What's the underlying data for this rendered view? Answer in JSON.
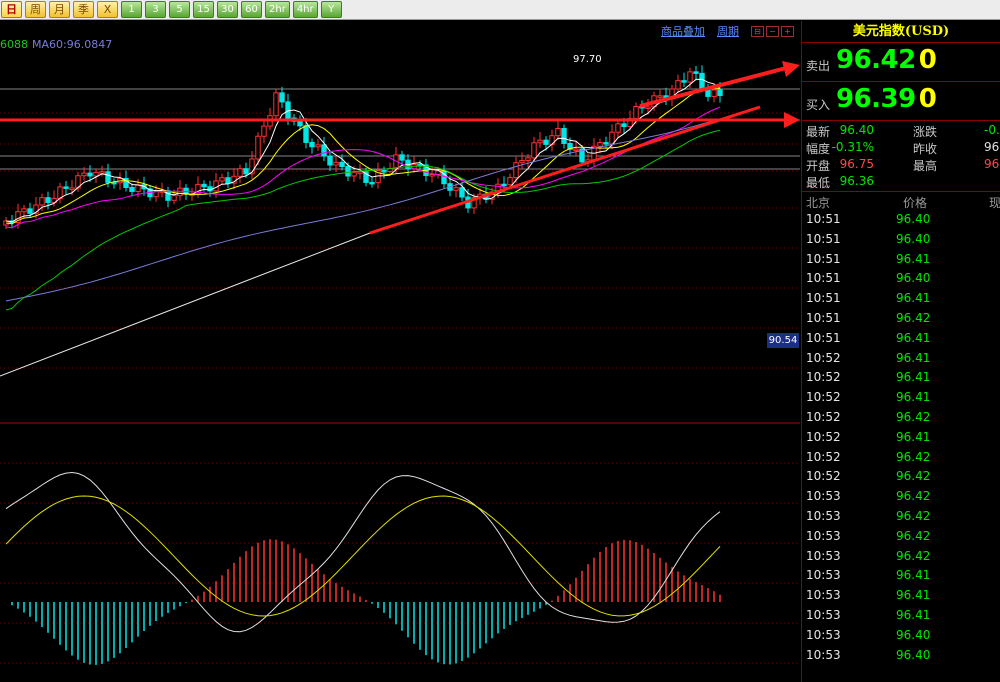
{
  "toolbar": {
    "buttons": [
      {
        "label": "日",
        "style": "first"
      },
      {
        "label": "周",
        "style": "yellow"
      },
      {
        "label": "月",
        "style": "yellow"
      },
      {
        "label": "季",
        "style": "yellow"
      },
      {
        "label": "X",
        "style": "yellow"
      },
      {
        "label": "1",
        "style": "green"
      },
      {
        "label": "3",
        "style": "green"
      },
      {
        "label": "5",
        "style": "green"
      },
      {
        "label": "15",
        "style": "green"
      },
      {
        "label": "30",
        "style": "green"
      },
      {
        "label": "60",
        "style": "green"
      },
      {
        "label": "2hr",
        "style": "green"
      },
      {
        "label": "4hr",
        "style": "green"
      },
      {
        "label": "Y",
        "style": "green"
      }
    ]
  },
  "chart": {
    "ma_legend_a": "6088",
    "ma_legend_b": "MA60:96.0847",
    "overlay_link": "商品叠加",
    "period_link": "周期",
    "high_label": "97.70",
    "cursor_price": "90.54",
    "colors": {
      "up": "#ff3232",
      "down": "#00e6e6",
      "grid": "#7a0000",
      "ma5": "#ffffff",
      "ma10": "#ffff00",
      "ma20": "#ff00ff",
      "ma30": "#00c800",
      "ma60": "#7b7bd6",
      "annotation": "#ff1e1e"
    }
  },
  "panel": {
    "title": "美元指数(USD)",
    "sell_label": "卖出",
    "sell_value": "96.42",
    "sell_suffix": "0",
    "buy_label": "买入",
    "buy_value": "96.39",
    "buy_suffix": "0",
    "stats": [
      {
        "k1": "最新",
        "v1": "96.40",
        "c1": "c-green",
        "k2": "涨跌",
        "v2": "-0.",
        "c2": "c-green"
      },
      {
        "k1": "幅度",
        "v1": "-0.31%",
        "c1": "c-green",
        "k2": "昨收",
        "v2": "96.",
        "c2": "c-white"
      },
      {
        "k1": "开盘",
        "v1": "96.75",
        "c1": "c-red",
        "k2": "最高",
        "v2": "96.",
        "c2": "c-red"
      },
      {
        "k1": "最低",
        "v1": "96.36",
        "c1": "c-green",
        "k2": "",
        "v2": "",
        "c2": "c-white"
      }
    ],
    "tick_headers": {
      "time": "北京",
      "price": "价格",
      "vol": "现"
    },
    "ticks": [
      {
        "time": "10:51",
        "price": "96.40"
      },
      {
        "time": "10:51",
        "price": "96.40"
      },
      {
        "time": "10:51",
        "price": "96.41"
      },
      {
        "time": "10:51",
        "price": "96.40"
      },
      {
        "time": "10:51",
        "price": "96.41"
      },
      {
        "time": "10:51",
        "price": "96.42"
      },
      {
        "time": "10:51",
        "price": "96.41"
      },
      {
        "time": "10:52",
        "price": "96.41"
      },
      {
        "time": "10:52",
        "price": "96.41"
      },
      {
        "time": "10:52",
        "price": "96.41"
      },
      {
        "time": "10:52",
        "price": "96.42"
      },
      {
        "time": "10:52",
        "price": "96.41"
      },
      {
        "time": "10:52",
        "price": "96.42"
      },
      {
        "time": "10:52",
        "price": "96.42"
      },
      {
        "time": "10:53",
        "price": "96.42"
      },
      {
        "time": "10:53",
        "price": "96.42"
      },
      {
        "time": "10:53",
        "price": "96.42"
      },
      {
        "time": "10:53",
        "price": "96.42"
      },
      {
        "time": "10:53",
        "price": "96.41"
      },
      {
        "time": "10:53",
        "price": "96.41"
      },
      {
        "time": "10:53",
        "price": "96.41"
      },
      {
        "time": "10:53",
        "price": "96.40"
      },
      {
        "time": "10:53",
        "price": "96.40"
      }
    ]
  }
}
